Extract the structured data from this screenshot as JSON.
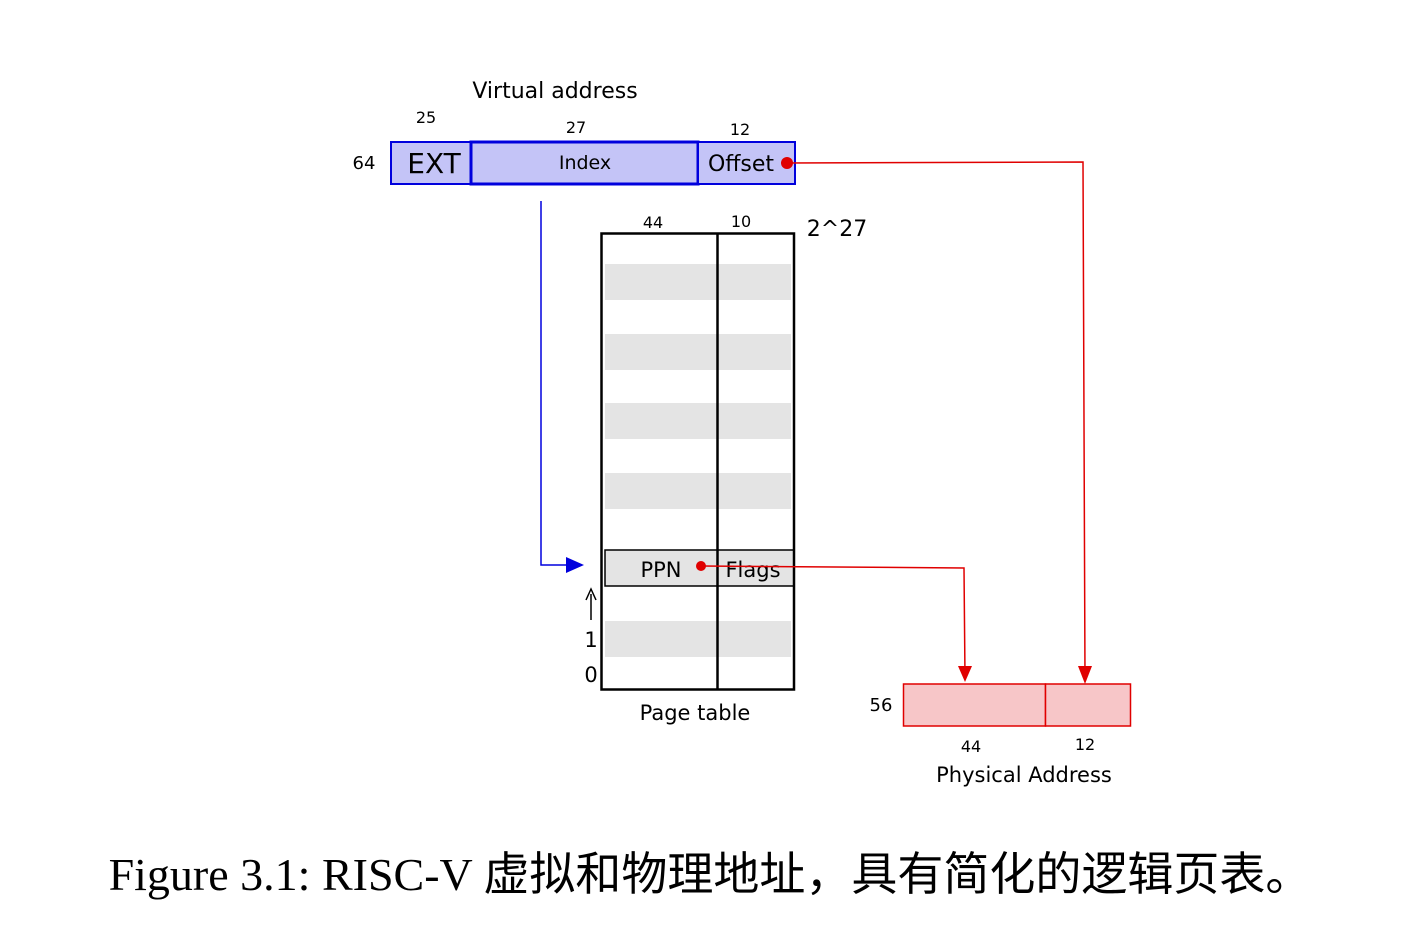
{
  "virtual_address": {
    "title": "Virtual address",
    "total_bits": "64",
    "fields": [
      {
        "label": "EXT",
        "bits": "25"
      },
      {
        "label": "Index",
        "bits": "27"
      },
      {
        "label": "Offset",
        "bits": "12"
      }
    ]
  },
  "page_table": {
    "label": "Page table",
    "col_bits": [
      "44",
      "10"
    ],
    "size_label": "2^27",
    "entry": {
      "ppn": "PPN",
      "flags": "Flags"
    },
    "row_labels": [
      "1",
      "0"
    ]
  },
  "physical_address": {
    "label": "Physical Address",
    "total_bits": "56",
    "fields_bits": [
      "44",
      "12"
    ]
  },
  "caption": "Figure 3.1: RISC-V 虚拟和物理地址，具有简化的逻辑页表。",
  "colors": {
    "virtual_fill": "#c4c4f7",
    "virtual_stroke": "#0000dd",
    "physical_fill": "#f7c6c8",
    "physical_stroke": "#e00000",
    "row_shade": "#e4e4e4"
  }
}
